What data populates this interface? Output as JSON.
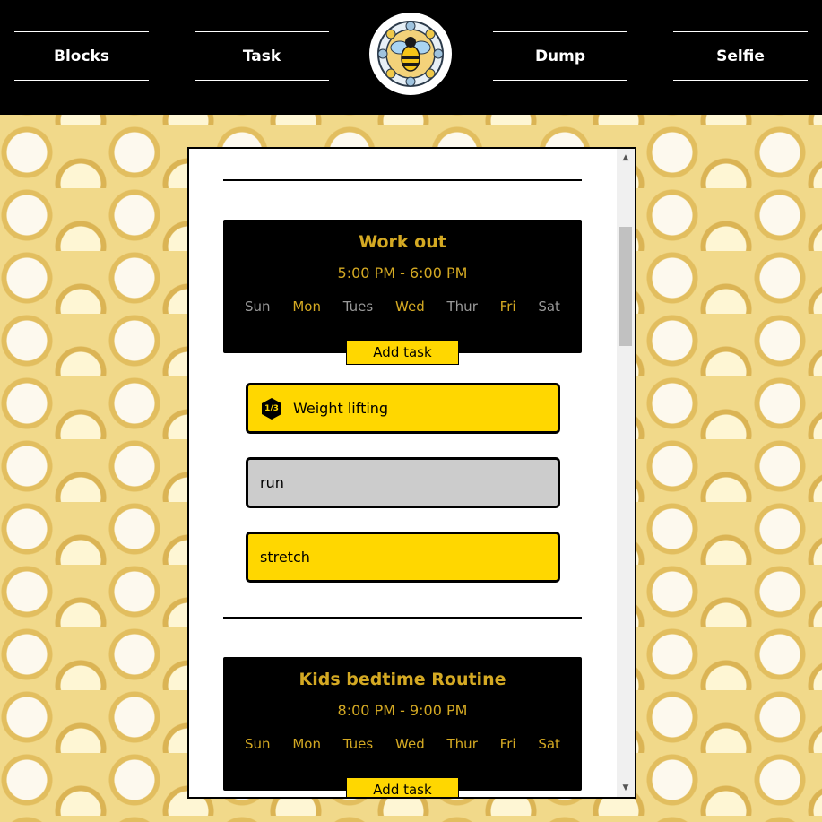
{
  "nav": {
    "items": [
      {
        "label": "Blocks"
      },
      {
        "label": "Task"
      },
      {
        "label": "Dump"
      },
      {
        "label": "Selfie"
      }
    ]
  },
  "colors": {
    "accent_gold": "#d4a923",
    "task_yellow": "#ffd700",
    "task_done_gray": "#cccccc"
  },
  "blocks": [
    {
      "title": "Work out",
      "time": "5:00 PM - 6:00 PM",
      "days": [
        {
          "label": "Sun",
          "active": false
        },
        {
          "label": "Mon",
          "active": true
        },
        {
          "label": "Tues",
          "active": false
        },
        {
          "label": "Wed",
          "active": true
        },
        {
          "label": "Thur",
          "active": false
        },
        {
          "label": "Fri",
          "active": true
        },
        {
          "label": "Sat",
          "active": false
        }
      ],
      "add_task_label": "Add task",
      "tasks": [
        {
          "label": "Weight lifting",
          "badge": "1/3",
          "state": "yellow"
        },
        {
          "label": "run",
          "state": "gray"
        },
        {
          "label": "stretch",
          "state": "yellow"
        }
      ]
    },
    {
      "title": "Kids bedtime Routine",
      "time": "8:00 PM - 9:00 PM",
      "days": [
        {
          "label": "Sun",
          "active": true
        },
        {
          "label": "Mon",
          "active": true
        },
        {
          "label": "Tues",
          "active": true
        },
        {
          "label": "Wed",
          "active": true
        },
        {
          "label": "Thur",
          "active": true
        },
        {
          "label": "Fri",
          "active": true
        },
        {
          "label": "Sat",
          "active": true
        }
      ],
      "add_task_label": "Add task"
    }
  ]
}
